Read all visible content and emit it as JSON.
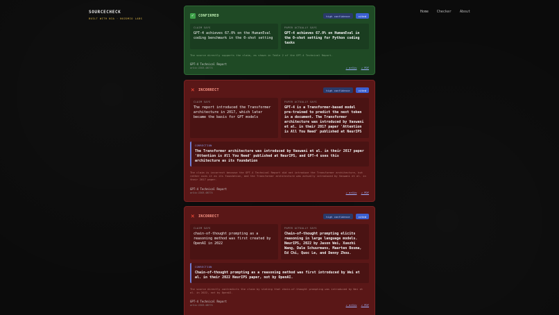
{
  "header": {
    "brand": "SOURCECHECK",
    "tagline": "BUILT WITH NIA · NOZOMIO LABS",
    "nav": [
      "Home",
      "Checker",
      "About"
    ]
  },
  "labels": {
    "claim_says": "CLAIM SAYS",
    "paper_says": "PAPER ACTUALLY SAYS",
    "correction": "CORRECTION",
    "arxiv": "↗ arXiv",
    "pdf": "↗ PDF"
  },
  "cards": [
    {
      "verdict": "CONFIRMED",
      "confidence": "high confidence",
      "status": "cited",
      "claim": "GPT-4 achieves 67.0% on the HumanEval coding benchmark in the 0-shot setting",
      "paper": "GPT-4 achieves 67.0% on HumanEval in the 0-shot setting for Python coding tasks",
      "correction": "",
      "explanation": "The source directly supports the claim, as shown in Table 2 of the GPT-4 Technical Report.",
      "source_title": "GPT-4 Technical Report",
      "source_id": "arXiv:2303.08774"
    },
    {
      "verdict": "INCORRECT",
      "confidence": "high confidence",
      "status": "cited",
      "claim": "The report introduced the Transformer architecture in 2017, which later became the basis for GPT models",
      "paper": "GPT-4 is a Transformer-based model pre-trained to predict the next token in a document. The Transformer architecture was introduced by Vaswani et al. in their 2017 paper 'Attention is All You Need' published at NeurIPS",
      "correction": "The Transformer architecture was introduced by Vaswani et al. in their 2017 paper 'Attention is All You Need' published at NeurIPS, and GPT-4 uses this architecture as its foundation",
      "explanation": "The claim is incorrect because the GPT-4 Technical Report did not introduce the Transformer architecture, but rather uses it as its foundation, and the Transformer architecture was actually introduced by Vaswani et al. in their 2017 paper.",
      "source_title": "GPT-4 Technical Report",
      "source_id": "arXiv:2303.08774"
    },
    {
      "verdict": "INCORRECT",
      "confidence": "high confidence",
      "status": "cited",
      "claim": "chain-of-thought prompting as a reasoning method was first created by OpenAI in 2022",
      "paper": "Chain-of-thought prompting elicits reasoning in large language models. NeurIPS, 2022 by Jason Wei, Xuezhi Wang, Dale Schuurmans, Maarten Bosma, Ed Chi, Quoc Le, and Denny Zhou.",
      "correction": "Chain-of-thought prompting as a reasoning method was first introduced by Wei et al. in their 2022 NeurIPS paper, not by OpenAI.",
      "explanation": "The source directly contradicts the claim by stating that chain-of-thought prompting was introduced by Wei et al. in 2022, not by OpenAI.",
      "source_title": "GPT-4 Technical Report",
      "source_id": "arXiv:2303.08774"
    }
  ]
}
